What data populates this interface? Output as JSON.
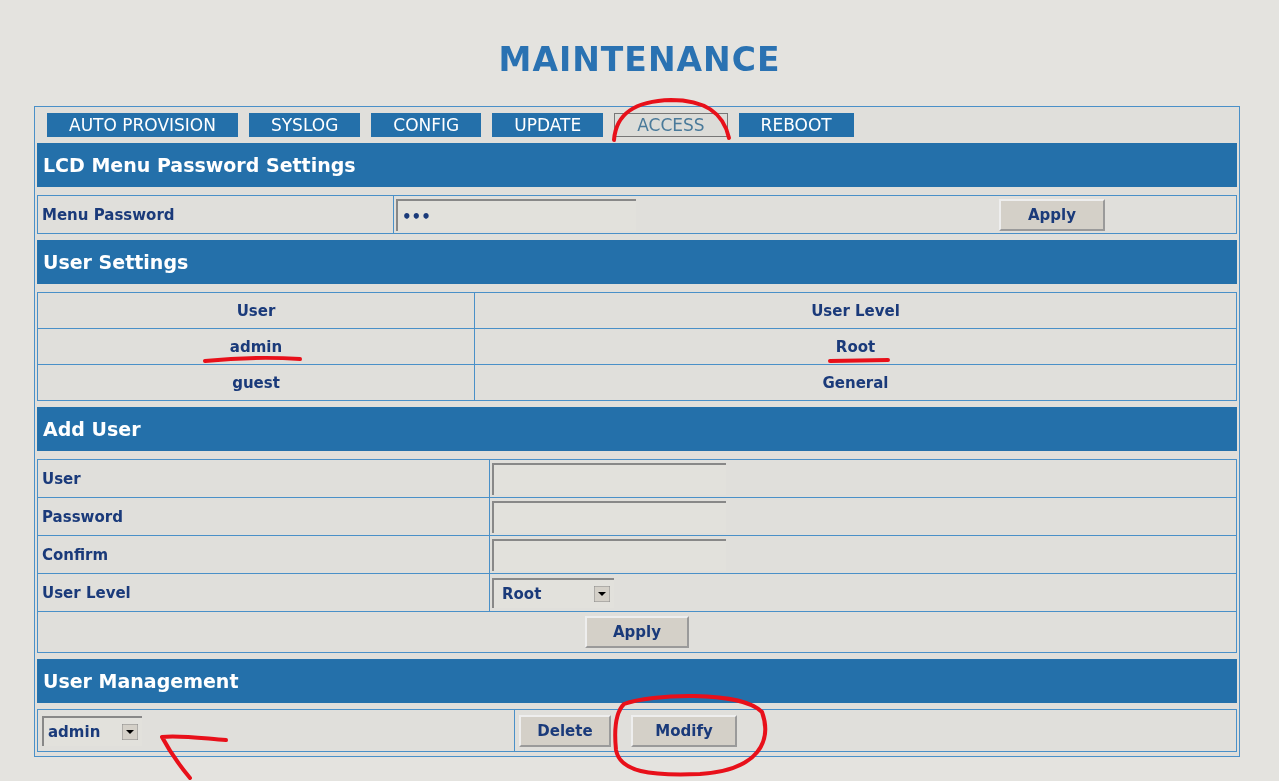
{
  "title": "MAINTENANCE",
  "tabs": [
    {
      "label": "AUTO PROVISION",
      "selected": false
    },
    {
      "label": "SYSLOG",
      "selected": false
    },
    {
      "label": "CONFIG",
      "selected": false
    },
    {
      "label": "UPDATE",
      "selected": false
    },
    {
      "label": "ACCESS",
      "selected": true
    },
    {
      "label": "REBOOT",
      "selected": false
    }
  ],
  "lcd_section": {
    "heading": "LCD Menu Password Settings",
    "label": "Menu Password",
    "value": "•••",
    "button": "Apply"
  },
  "user_settings": {
    "heading": "User Settings",
    "columns": [
      "User",
      "User Level"
    ],
    "rows": [
      {
        "user": "admin",
        "level": "Root"
      },
      {
        "user": "guest",
        "level": "General"
      }
    ]
  },
  "add_user": {
    "heading": "Add User",
    "fields": [
      {
        "kind": "text",
        "label": "User"
      },
      {
        "kind": "text",
        "label": "Password"
      },
      {
        "kind": "text",
        "label": "Confirm"
      },
      {
        "kind": "select",
        "label": "User Level",
        "value": "Root"
      }
    ],
    "button": "Apply"
  },
  "user_management": {
    "heading": "User Management",
    "selected_user": "admin",
    "buttons": [
      "Delete",
      "Modify"
    ]
  }
}
